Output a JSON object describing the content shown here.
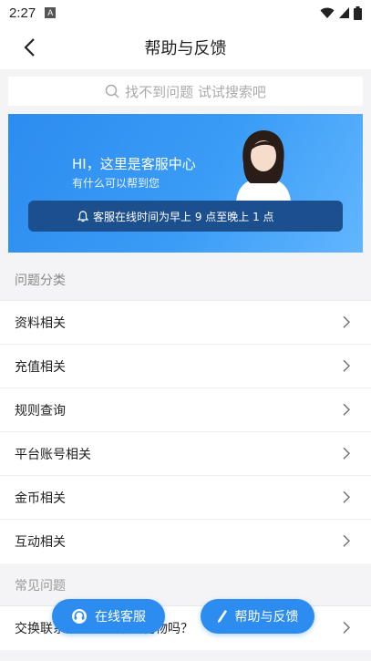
{
  "status_bar": {
    "time": "2:27",
    "notif": "A"
  },
  "header": {
    "title": "帮助与反馈"
  },
  "search": {
    "placeholder": "找不到问题 试试搜索吧"
  },
  "banner": {
    "title": "HI，这里是客服中心",
    "subtitle": "有什么可以帮到您",
    "notice": "客服在线时间为早上 9 点至晚上 1 点"
  },
  "categories": {
    "label": "问题分类",
    "items": [
      "资料相关",
      "充值相关",
      "规则查询",
      "平台账号相关",
      "金币相关",
      "互动相关"
    ]
  },
  "faq": {
    "label": "常见问题",
    "items": [
      "交换联系方式需要赠送礼物吗？"
    ]
  },
  "fab": {
    "service": "在线客服",
    "feedback": "帮助与反馈"
  },
  "colors": {
    "accent": "#2d8cf0",
    "notice_bg": "#1c4f8e"
  }
}
